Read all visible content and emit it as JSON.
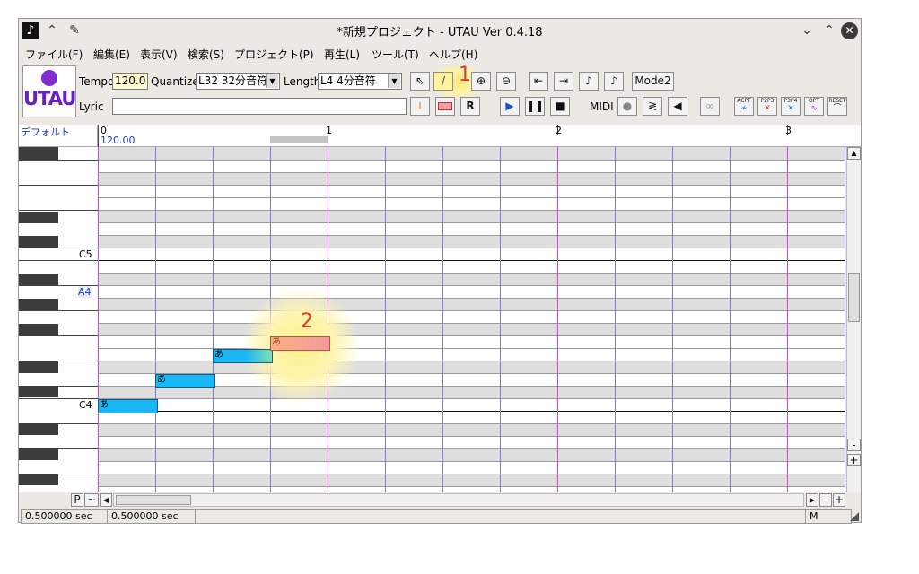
{
  "window": {
    "title": "*新規プロジェクト - UTAU Ver 0.4.18"
  },
  "menu": [
    "ファイル(F)",
    "編集(E)",
    "表示(V)",
    "検索(S)",
    "プロジェクト(P)",
    "再生(L)",
    "ツール(T)",
    "ヘルプ(H)"
  ],
  "logo": {
    "text": "UTAU"
  },
  "toolbar": {
    "tempo_label": "Tempo",
    "tempo_value": "120.0",
    "quantize_label": "Quantize",
    "quantize_value": "L32 32分音符",
    "length_label": "Length",
    "length_value": "L4 4分音符",
    "lyric_label": "Lyric",
    "lyric_value": "",
    "mode_button": "Mode2",
    "midi_label": "MIDI",
    "plugin_buttons": [
      "ACPT",
      "P2P3",
      "P3P4",
      "OPT",
      "RESET"
    ]
  },
  "annotations": {
    "marker1": "1",
    "marker2": "2"
  },
  "track": {
    "name": "デフォルト"
  },
  "ruler": {
    "measures": [
      "0",
      "1",
      "2",
      "3"
    ],
    "tempo": "120.00"
  },
  "keys": {
    "c5": "C5",
    "a4": "A4",
    "c4": "C4"
  },
  "notes": [
    {
      "lyric": "あ",
      "pitch": "C4"
    },
    {
      "lyric": "あ",
      "pitch": "D4"
    },
    {
      "lyric": "あ",
      "pitch": "E4"
    },
    {
      "lyric": "あ",
      "pitch": "F4"
    }
  ],
  "scroll_buttons": {
    "p": "P",
    "tilde": "~",
    "minus": "-",
    "plus": "+"
  },
  "status": {
    "left": "0.500000 sec",
    "center": "0.500000 sec",
    "mode": "M"
  },
  "colors": {
    "note_fill": "#19b7f5",
    "selected_note": "#f4a08c",
    "highlight": "#ffe97a"
  }
}
